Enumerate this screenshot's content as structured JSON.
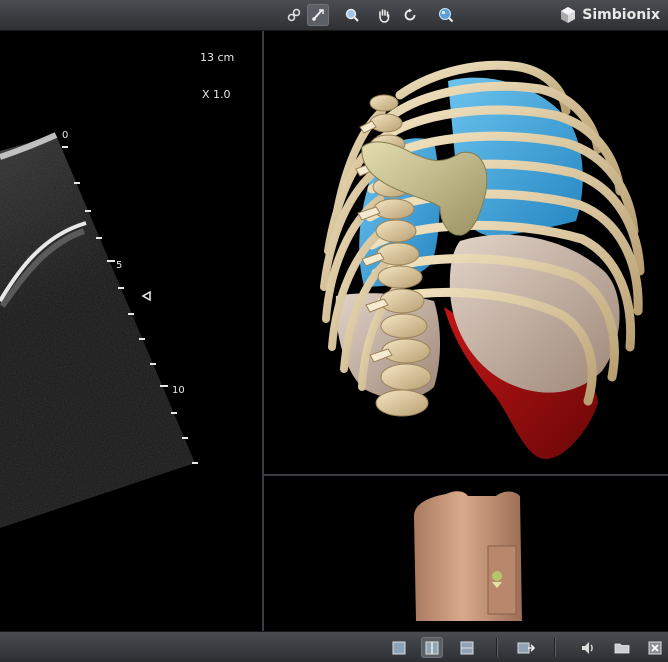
{
  "toolbar": {
    "buttons": [
      {
        "icon": "link-icon"
      },
      {
        "icon": "probe-tool-icon",
        "active": true
      },
      {
        "icon": "zoom-icon"
      },
      {
        "icon": "pan-hand-icon"
      },
      {
        "icon": "rotate-icon"
      },
      {
        "icon": "zoom-sphere-icon"
      }
    ],
    "brand": "Simbionix"
  },
  "ultrasound": {
    "depth_label": "13 cm",
    "zoom_label": "X 1.0",
    "scale_ticks": [
      "0",
      "5",
      "10"
    ]
  },
  "bottom_toolbar": {
    "buttons": [
      {
        "icon": "single-view-icon"
      },
      {
        "icon": "dual-view-icon",
        "active": true
      },
      {
        "icon": "triple-view-icon"
      },
      {
        "icon": "export-icon"
      },
      {
        "icon": "audio-icon"
      },
      {
        "icon": "folder-icon"
      },
      {
        "icon": "close-icon"
      }
    ]
  },
  "colors": {
    "bone": "#d8c49a",
    "lung": "#3aa4d8",
    "heart": "#c8b5a6",
    "liver": "#9a1010",
    "probe": "#c9c28a",
    "phantom": "#c59476"
  }
}
